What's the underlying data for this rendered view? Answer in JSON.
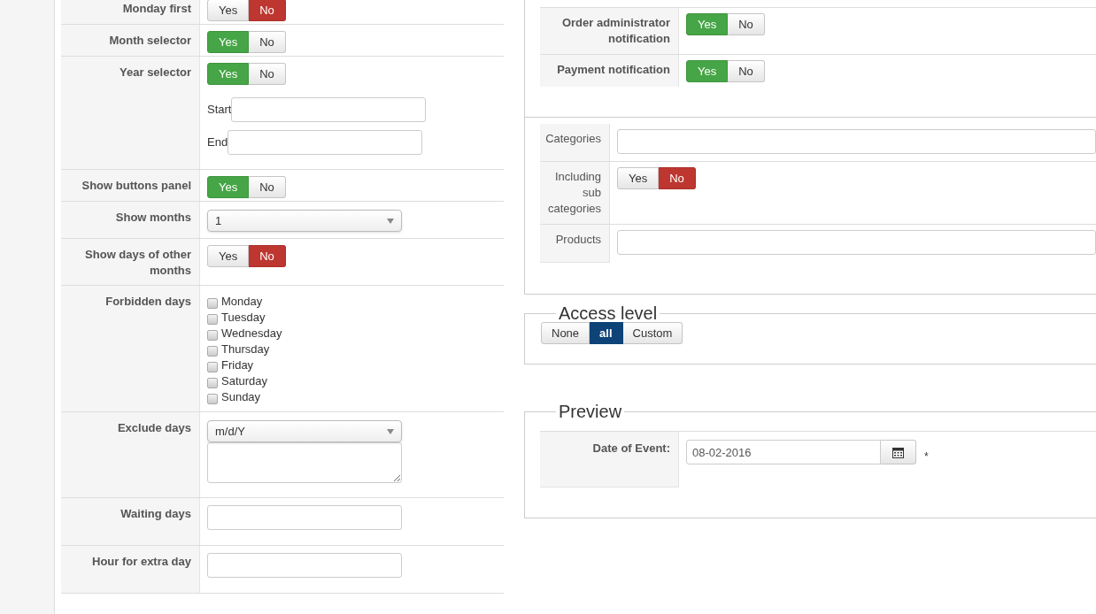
{
  "calendar_settings": [
    {
      "kind": "toggle",
      "label": "Monday first",
      "options": [
        {
          "label": "Yes",
          "selected": false
        },
        {
          "label": "No",
          "selected": true
        }
      ]
    },
    {
      "kind": "toggle",
      "label": "Month selector",
      "options": [
        {
          "label": "Yes",
          "selected": true
        },
        {
          "label": "No",
          "selected": false
        }
      ]
    },
    {
      "kind": "toggle_range",
      "label": "Year selector",
      "options": [
        {
          "label": "Yes",
          "selected": true
        },
        {
          "label": "No",
          "selected": false
        }
      ],
      "fields": [
        {
          "label": "Start"
        },
        {
          "label": "End"
        }
      ]
    },
    {
      "kind": "toggle",
      "label": "Show buttons panel",
      "options": [
        {
          "label": "Yes",
          "selected": true
        },
        {
          "label": "No",
          "selected": false
        }
      ]
    },
    {
      "kind": "select",
      "label": "Show months",
      "value": "1"
    },
    {
      "kind": "toggle",
      "label": "Show days of other months",
      "options": [
        {
          "label": "Yes",
          "selected": false
        },
        {
          "label": "No",
          "selected": true
        }
      ]
    },
    {
      "kind": "checkboxes",
      "label": "Forbidden days",
      "items": [
        {
          "label": "Monday",
          "checked": false
        },
        {
          "label": "Tuesday",
          "checked": false
        },
        {
          "label": "Wednesday",
          "checked": false
        },
        {
          "label": "Thursday",
          "checked": false
        },
        {
          "label": "Friday",
          "checked": false
        },
        {
          "label": "Saturday",
          "checked": false
        },
        {
          "label": "Sunday",
          "checked": false
        }
      ]
    },
    {
      "kind": "select_textarea",
      "label": "Exclude days",
      "value": "m/d/Y"
    },
    {
      "kind": "text",
      "label": "Waiting days"
    },
    {
      "kind": "text",
      "label": "Hour for extra day"
    }
  ],
  "notifications": [
    {
      "label": "Order administrator notification",
      "options": [
        {
          "label": "Yes",
          "selected": true
        },
        {
          "label": "No",
          "selected": false
        }
      ]
    },
    {
      "label": "Payment notification",
      "options": [
        {
          "label": "Yes",
          "selected": true
        },
        {
          "label": "No",
          "selected": false
        }
      ]
    }
  ],
  "filters": [
    {
      "kind": "text",
      "label": "Categories"
    },
    {
      "kind": "toggle",
      "label": "Including sub categories",
      "options": [
        {
          "label": "Yes",
          "selected": false
        },
        {
          "label": "No",
          "selected": true
        }
      ]
    },
    {
      "kind": "text",
      "label": "Products"
    }
  ],
  "access_level": {
    "title": "Access level",
    "options": [
      {
        "label": "None",
        "selected": false
      },
      {
        "label": "all",
        "selected": true
      },
      {
        "label": "Custom",
        "selected": false
      }
    ]
  },
  "preview": {
    "title": "Preview",
    "label": "Date of Event:",
    "value": "08-02-2016",
    "required_mark": "*"
  }
}
